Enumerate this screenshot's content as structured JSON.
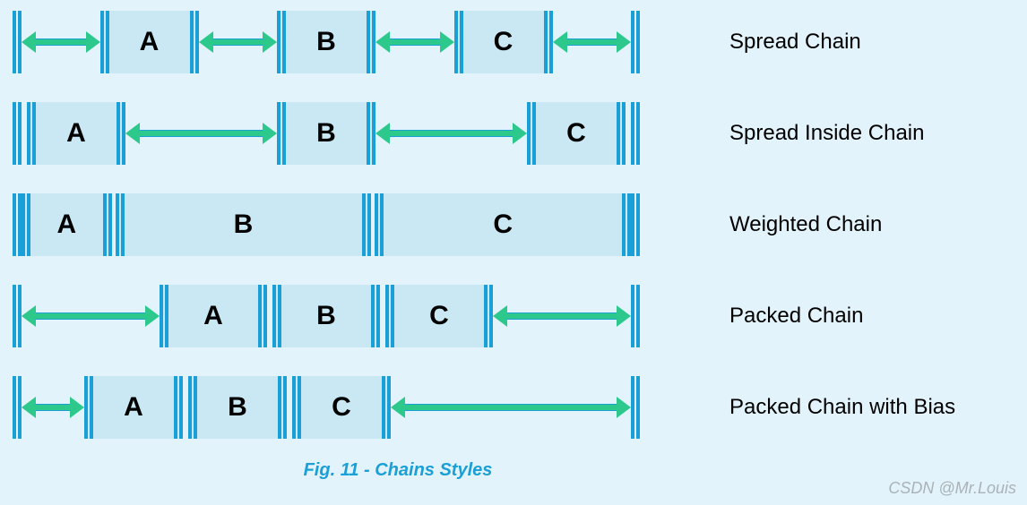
{
  "chart_data": {
    "type": "table",
    "title": "Fig. 11 - Chains Styles",
    "rows": [
      {
        "style_name": "Spread Chain",
        "layout": "Elements A, B, C evenly spread with equal gaps on all sides including outer endpoints",
        "boxes": [
          "A",
          "B",
          "C"
        ],
        "gap_positions": [
          "before-A",
          "A-B",
          "B-C",
          "after-C"
        ]
      },
      {
        "style_name": "Spread Inside Chain",
        "layout": "Elements A, B, C at edges; gaps only between elements, none outside",
        "boxes": [
          "A",
          "B",
          "C"
        ],
        "gap_positions": [
          "A-B",
          "B-C"
        ]
      },
      {
        "style_name": "Weighted Chain",
        "layout": "Elements fill entire width; A small, B and C large (weighted)",
        "boxes": [
          "A",
          "B",
          "C"
        ],
        "weights_approx": [
          1,
          3,
          3
        ]
      },
      {
        "style_name": "Packed Chain",
        "layout": "Elements A, B, C packed together centered; equal outer gaps",
        "boxes": [
          "A",
          "B",
          "C"
        ],
        "gap_positions": [
          "before-pack",
          "after-pack"
        ]
      },
      {
        "style_name": "Packed Chain with Bias",
        "layout": "Elements A, B, C packed together biased toward start; small left gap, large right gap",
        "boxes": [
          "A",
          "B",
          "C"
        ],
        "gap_positions": [
          "before-pack-small",
          "after-pack-large"
        ]
      }
    ]
  },
  "rows": [
    {
      "label": "Spread Chain",
      "boxes": [
        "A",
        "B",
        "C"
      ]
    },
    {
      "label": "Spread Inside Chain",
      "boxes": [
        "A",
        "B",
        "C"
      ]
    },
    {
      "label": "Weighted Chain",
      "boxes": [
        "A",
        "B",
        "C"
      ]
    },
    {
      "label": "Packed Chain",
      "boxes": [
        "A",
        "B",
        "C"
      ]
    },
    {
      "label": "Packed Chain with Bias",
      "boxes": [
        "A",
        "B",
        "C"
      ]
    }
  ],
  "caption": "Fig. 11 - Chains Styles",
  "watermark": "CSDN @Mr.Louis"
}
